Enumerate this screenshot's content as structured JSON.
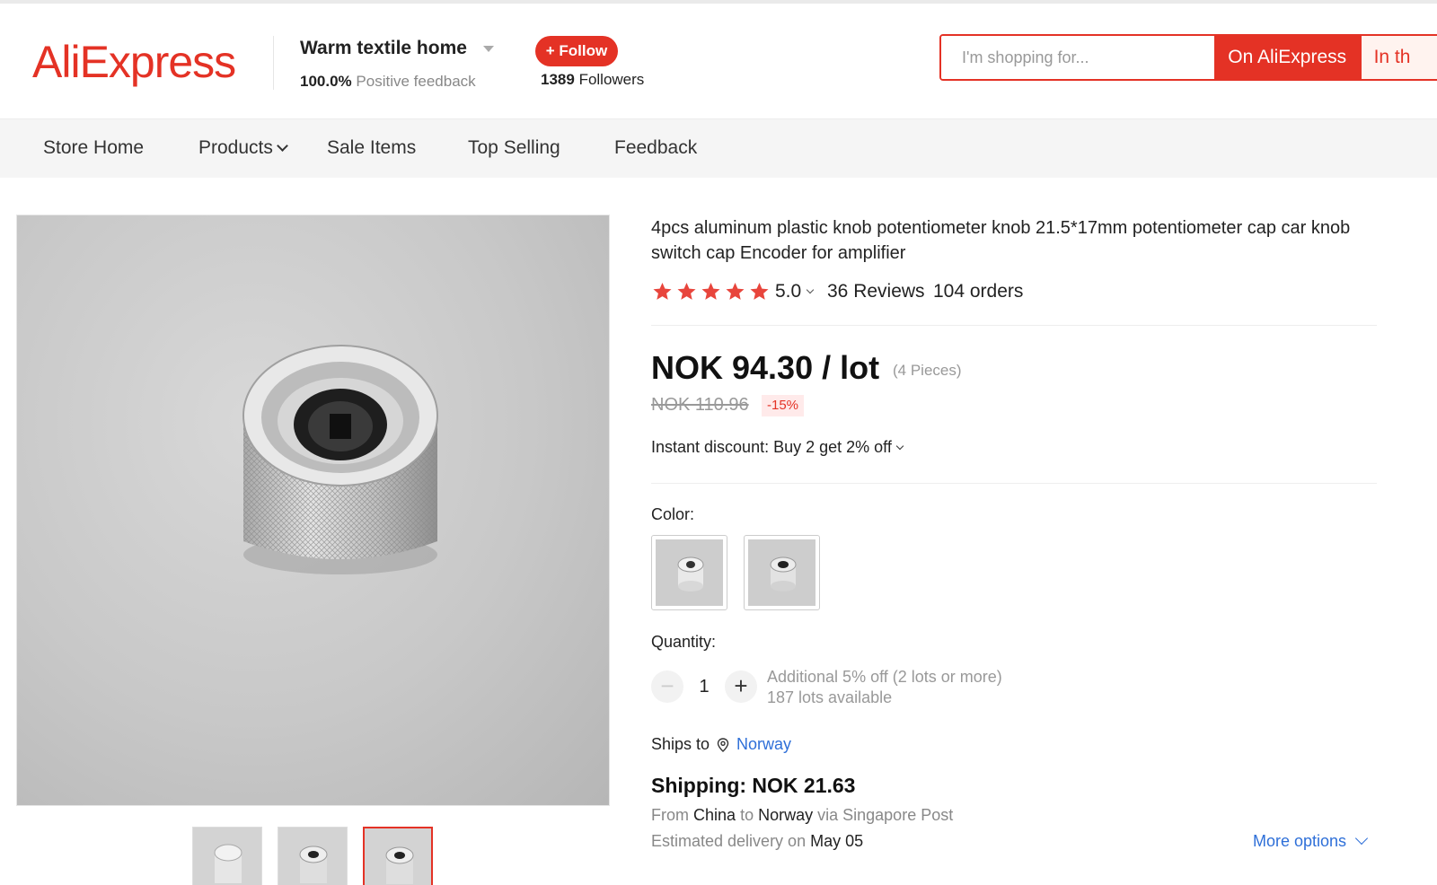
{
  "header": {
    "logo": "AliExpress",
    "store_name": "Warm textile home",
    "feedback_pct": "100.0%",
    "feedback_label": "Positive feedback",
    "follow_label": "+ Follow",
    "followers_count": "1389",
    "followers_label": "Followers"
  },
  "search": {
    "placeholder": "I'm shopping for...",
    "on_aliexpress_label": "On AliExpress",
    "in_store_label": "In th"
  },
  "nav": {
    "store_home": "Store Home",
    "products": "Products",
    "sale_items": "Sale Items",
    "top_selling": "Top Selling",
    "feedback": "Feedback"
  },
  "product": {
    "title": "4pcs aluminum plastic knob potentiometer knob 21.5*17mm potentiometer cap car knob switch cap Encoder for amplifier",
    "rating": "5.0",
    "stars": 5,
    "reviews": "36 Reviews",
    "orders": "104 orders",
    "price": "NOK 94.30 / lot",
    "price_unit": "(4 Pieces)",
    "old_price": "NOK 110.96",
    "discount": "-15%",
    "instant_discount": "Instant discount: Buy 2 get 2% off",
    "color_label": "Color:",
    "quantity_label": "Quantity:",
    "quantity_value": "1",
    "qty_minus": "−",
    "qty_plus": "+",
    "qty_note_1": "Additional 5% off (2 lots or more)",
    "qty_note_2": "187 lots available",
    "ships_to_label": "Ships to",
    "ships_to_country": "Norway",
    "shipping": "Shipping: NOK 21.63",
    "from_label": "From",
    "from_country": "China",
    "to_label": "to",
    "to_country": "Norway",
    "via_label": "via Singapore Post",
    "delivery_label": "Estimated delivery on",
    "delivery_date": "May 05",
    "more_options": "More options"
  },
  "colors": {
    "accent": "#e43225",
    "link": "#2e6fd8",
    "star": "#e8453c"
  }
}
